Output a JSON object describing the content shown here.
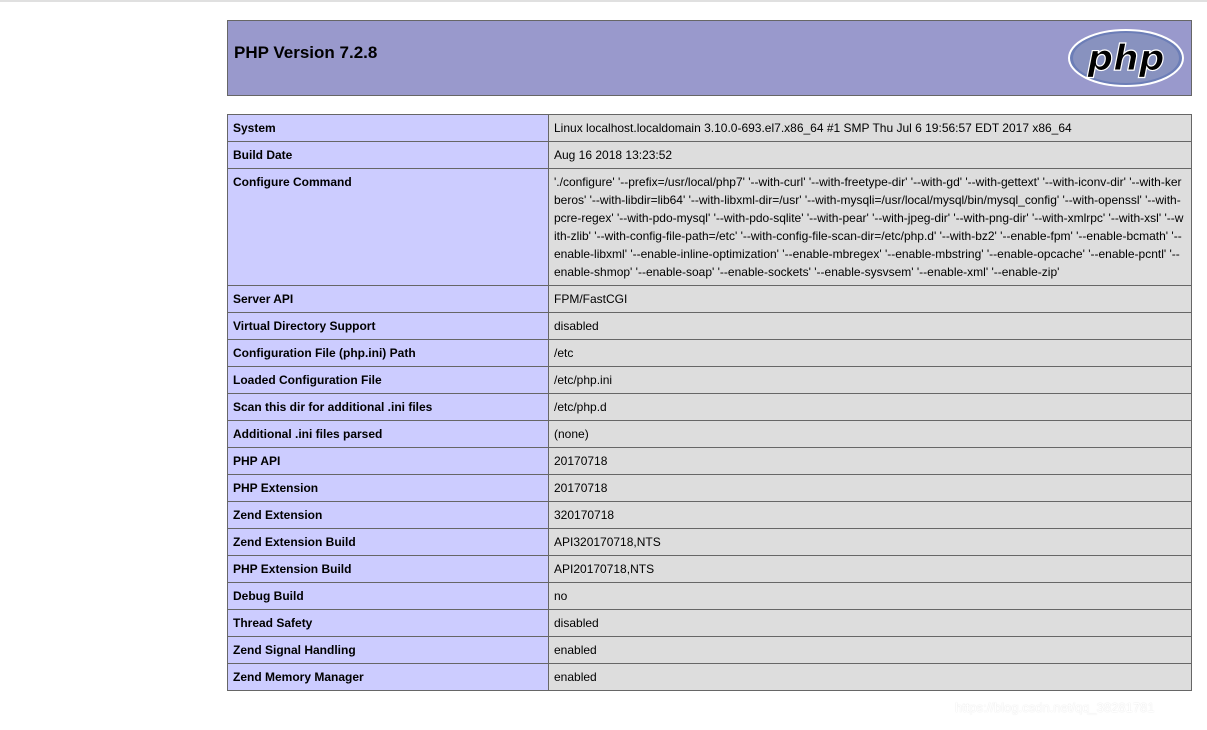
{
  "header": {
    "title": "PHP Version 7.2.8",
    "logo_text": "php"
  },
  "rows": [
    {
      "key": "System",
      "value": "Linux localhost.localdomain 3.10.0-693.el7.x86_64 #1 SMP Thu Jul 6 19:56:57 EDT 2017 x86_64"
    },
    {
      "key": "Build Date",
      "value": "Aug 16 2018 13:23:52"
    },
    {
      "key": "Configure Command",
      "value": "'./configure' '--prefix=/usr/local/php7' '--with-curl' '--with-freetype-dir' '--with-gd' '--with-gettext' '--with-iconv-dir' '--with-kerberos' '--with-libdir=lib64' '--with-libxml-dir=/usr' '--with-mysqli=/usr/local/mysql/bin/mysql_config' '--with-openssl' '--with-pcre-regex' '--with-pdo-mysql' '--with-pdo-sqlite' '--with-pear' '--with-jpeg-dir' '--with-png-dir' '--with-xmlrpc' '--with-xsl' '--with-zlib' '--with-config-file-path=/etc' '--with-config-file-scan-dir=/etc/php.d' '--with-bz2' '--enable-fpm' '--enable-bcmath' '--enable-libxml' '--enable-inline-optimization' '--enable-mbregex' '--enable-mbstring' '--enable-opcache' '--enable-pcntl' '--enable-shmop' '--enable-soap' '--enable-sockets' '--enable-sysvsem' '--enable-xml' '--enable-zip'"
    },
    {
      "key": "Server API",
      "value": "FPM/FastCGI"
    },
    {
      "key": "Virtual Directory Support",
      "value": "disabled"
    },
    {
      "key": "Configuration File (php.ini) Path",
      "value": "/etc"
    },
    {
      "key": "Loaded Configuration File",
      "value": "/etc/php.ini"
    },
    {
      "key": "Scan this dir for additional .ini files",
      "value": "/etc/php.d"
    },
    {
      "key": "Additional .ini files parsed",
      "value": "(none)"
    },
    {
      "key": "PHP API",
      "value": "20170718"
    },
    {
      "key": "PHP Extension",
      "value": "20170718"
    },
    {
      "key": "Zend Extension",
      "value": "320170718"
    },
    {
      "key": "Zend Extension Build",
      "value": "API320170718,NTS"
    },
    {
      "key": "PHP Extension Build",
      "value": "API20170718,NTS"
    },
    {
      "key": "Debug Build",
      "value": "no"
    },
    {
      "key": "Thread Safety",
      "value": "disabled"
    },
    {
      "key": "Zend Signal Handling",
      "value": "enabled"
    },
    {
      "key": "Zend Memory Manager",
      "value": "enabled"
    }
  ],
  "watermark": "https://blog.csdn.net/qq_38281781",
  "colors": {
    "header_bg": "#9999cc",
    "key_bg": "#ccccff",
    "value_bg": "#dddddd",
    "logo_bg": "#8892bf",
    "logo_text": "#000000"
  }
}
